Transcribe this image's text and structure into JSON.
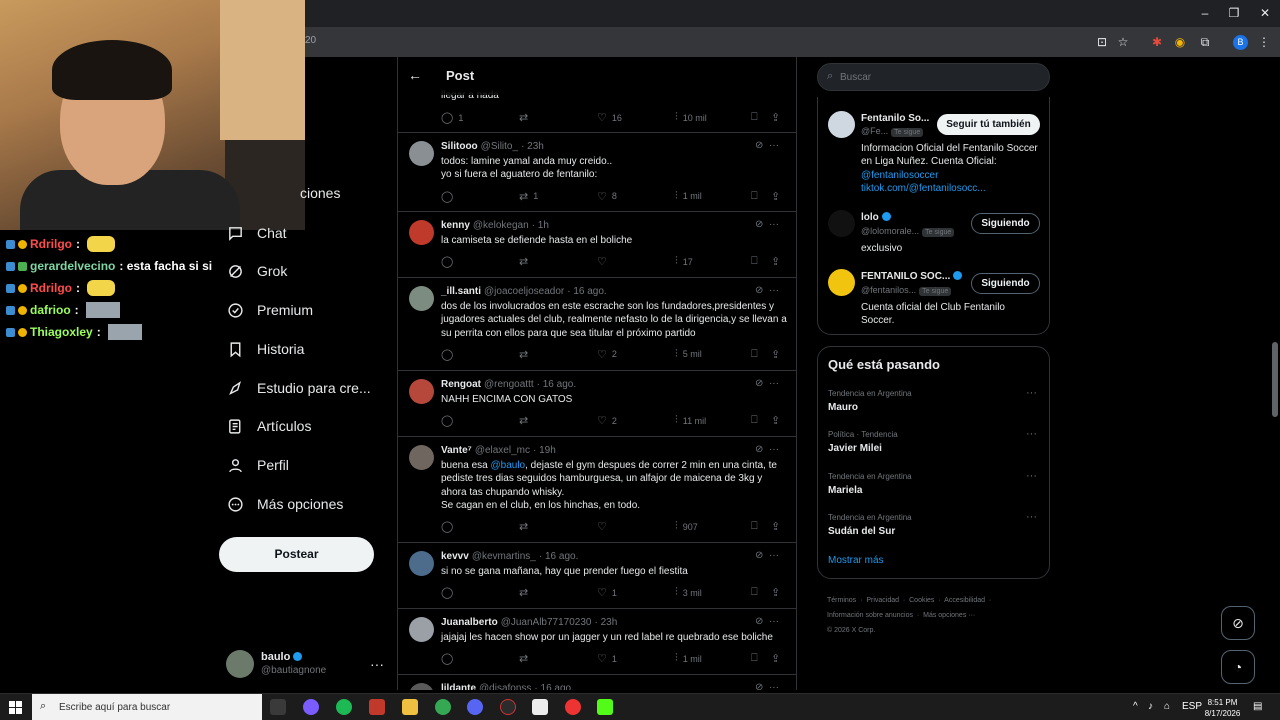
{
  "browser": {
    "address_fragment": "20",
    "profile_initial": "B"
  },
  "stream_chat": [
    {
      "name": "Rdrilgo",
      "name_color": "#ff4b4b",
      "message": "",
      "has_emote": true
    },
    {
      "name": "gerardelvecino",
      "name_color": "#7ed6a2",
      "message": "esta facha si si",
      "has_emote": false
    },
    {
      "name": "Rdrilgo",
      "name_color": "#ff4b4b",
      "message": "",
      "has_emote": true
    },
    {
      "name": "dafrioo",
      "name_color": "#9bff5b",
      "message": "",
      "has_emote": true
    },
    {
      "name": "Thiagoxley",
      "name_color": "#9bff5b",
      "message": "",
      "has_emote": true
    }
  ],
  "nav": {
    "partial_item": "ciones",
    "items": [
      "Chat",
      "Grok",
      "Premium",
      "Historia",
      "Estudio para cre...",
      "Artículos",
      "Perfil",
      "Más opciones"
    ],
    "post_button": "Postear",
    "user": {
      "name": "baulo",
      "handle": "@bautiagnone"
    }
  },
  "post": {
    "header_title": "Post",
    "top_fragment": {
      "text": "llegar a nada",
      "replies": "1",
      "reposts": "",
      "likes": "16",
      "views": "10 mil"
    },
    "replies": [
      {
        "name": "Silitooo",
        "handle": "@Silito_",
        "time": "· 23h",
        "text": "todos: lamine yamal anda muy creido..\nyo si fuera el aguatero de fentanilo:",
        "replies": "",
        "reposts": "1",
        "likes": "8",
        "views": "1 mil",
        "avatar_color": "#8a8f94"
      },
      {
        "name": "kenny",
        "handle": "@kelokegan",
        "time": "· 1h",
        "text": "la camiseta se defiende hasta en el boliche",
        "replies": "",
        "reposts": "",
        "likes": "",
        "views": "17",
        "avatar_color": "#c03a2b"
      },
      {
        "name": "_ill.santi",
        "handle": "@joacoeljoseador",
        "time": "· 16 ago.",
        "text": "dos de los involucrados en este escrache son los fundadores,presidentes y jugadores actuales del club, realmente nefasto lo de la dirigencia,y se llevan a su perrita con ellos para que sea titular el próximo partido",
        "replies": "",
        "reposts": "",
        "likes": "2",
        "views": "5 mil",
        "avatar_color": "#7d8c80"
      },
      {
        "name": "Rengoat",
        "handle": "@rengoattt",
        "time": "· 16 ago.",
        "text": "NAHH ENCIMA CON GATOS",
        "replies": "",
        "reposts": "",
        "likes": "2",
        "views": "11 mil",
        "avatar_color": "#b5483a"
      },
      {
        "name": "Vante⁷",
        "handle": "@elaxel_mc",
        "time": "· 19h",
        "text_parts": [
          "buena esa ",
          "@baulo",
          ", dejaste el gym despues de correr 2 min en una cinta, te pediste tres dias seguidos hamburguesa, un alfajor de maicena de 3kg y ahora tas chupando whisky.\nSe cagan en el club, en los hinchas, en todo."
        ],
        "replies": "",
        "reposts": "",
        "likes": "",
        "views": "907",
        "avatar_color": "#6f6660"
      },
      {
        "name": "kevvv",
        "handle": "@kevmartins_",
        "time": "· 16 ago.",
        "text": "si no se gana mañana, hay que prender fuego el fiestita",
        "replies": "",
        "reposts": "",
        "likes": "1",
        "views": "3 mil",
        "avatar_color": "#4d6b8a"
      },
      {
        "name": "Juanalberto",
        "handle": "@JuanAlb77170230",
        "time": "· 23h",
        "text": "jajajaj les hacen show por un jagger y un red label re quebrado ese boliche",
        "replies": "",
        "reposts": "",
        "likes": "1",
        "views": "1 mil",
        "avatar_color": "#9aa0a6"
      },
      {
        "name": "lildante",
        "handle": "@djsafonss",
        "time": "· 16 ago.",
        "text": "",
        "replies": "",
        "reposts": "",
        "likes": "",
        "views": "",
        "avatar_color": "#5a5a5a"
      }
    ]
  },
  "sidebar": {
    "search_placeholder": "Buscar",
    "follow": [
      {
        "name": "Fentanilo So...",
        "handle": "@Fe...",
        "tag": "Te sigue",
        "button": "Seguir tú también",
        "bio_parts": [
          "Informacion Oficial del Fentanilo Soccer en Liga Nuñez. Cuenta Oficial: ",
          "@fentanilosoccer",
          "tiktok.com/@fentanilosocc..."
        ],
        "verified": false
      },
      {
        "name": "lolo",
        "handle": "@lolomorale...",
        "tag": "Te sigue",
        "button": "Siguiendo",
        "bio": "exclusivo",
        "verified": true
      },
      {
        "name": "FENTANILO SOC...",
        "handle": "@fentanilos...",
        "tag": "Te sigue",
        "button": "Siguiendo",
        "bio": "Cuenta oficial del Club Fentanilo Soccer.",
        "verified": true
      }
    ],
    "trends_title": "Qué está pasando",
    "trends": [
      {
        "meta": "Tendencia en Argentina",
        "name": "Mauro"
      },
      {
        "meta": "Política · Tendencia",
        "name": "Javier Milei"
      },
      {
        "meta": "Tendencia en Argentina",
        "name": "Mariela"
      },
      {
        "meta": "Tendencia en Argentina",
        "name": "Sudán del Sur"
      }
    ],
    "show_more": "Mostrar más",
    "footer_links": [
      "Términos",
      "Privacidad",
      "Cookies",
      "Accesibilidad",
      "Información sobre anuncios",
      "Más opciones ···"
    ],
    "copyright": "© 2026 X Corp."
  },
  "taskbar": {
    "search_placeholder": "Escribe aquí para buscar",
    "language": "ESP",
    "time": "8:51 PM",
    "date": "8/17/2026"
  },
  "colors": {
    "accent": "#1d9bf0",
    "background": "#000000",
    "border": "#2f3336",
    "muted": "#71767b"
  }
}
